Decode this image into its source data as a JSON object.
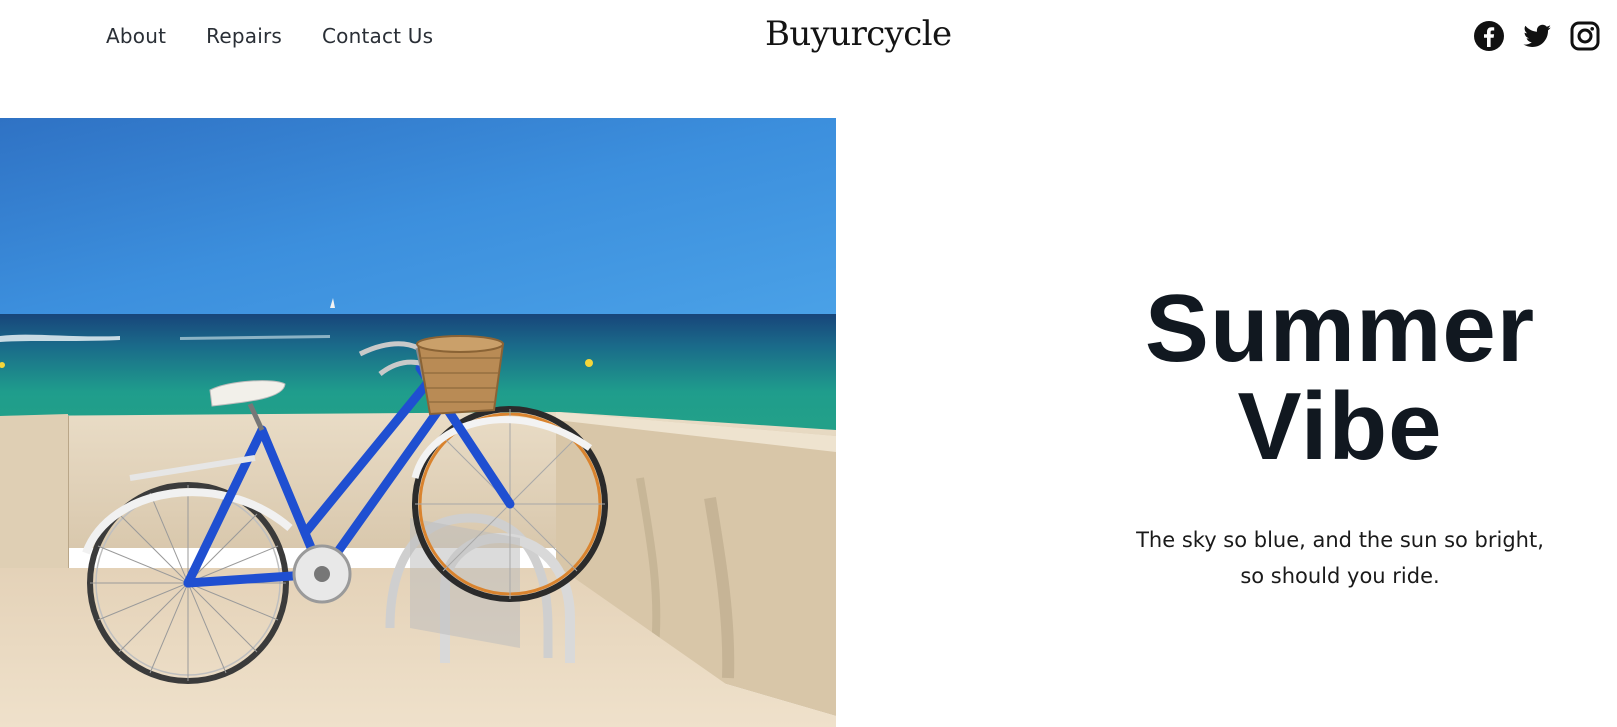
{
  "header": {
    "nav": [
      {
        "label": "About"
      },
      {
        "label": "Repairs"
      },
      {
        "label": "Contact Us"
      }
    ],
    "brand": "Buyurcycle",
    "social": [
      {
        "icon": "facebook-icon"
      },
      {
        "icon": "twitter-icon"
      },
      {
        "icon": "instagram-icon"
      }
    ]
  },
  "hero": {
    "title_line1": "Summer",
    "title_line2": "Vibe",
    "subtitle_line1": "The sky so blue, and the sun so bright,",
    "subtitle_line2": "so should you ride.",
    "image_subject": "blue bicycle with wicker basket by the sea"
  },
  "colors": {
    "sky": "#3f97e2",
    "sea": "#1e9a8a",
    "bicycle": "#1f4fd1",
    "title": "#111820"
  }
}
